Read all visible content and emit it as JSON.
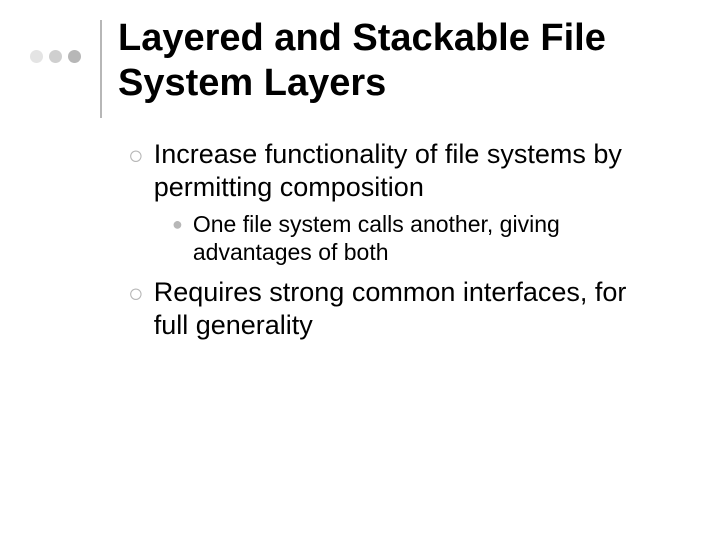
{
  "title": "Layered and Stackable File System Layers",
  "bullets": {
    "b1": "Increase functionality of file systems by permitting composition",
    "b1a": "One file system calls another, giving advantages of both",
    "b2": "Requires strong common interfaces, for full generality"
  }
}
